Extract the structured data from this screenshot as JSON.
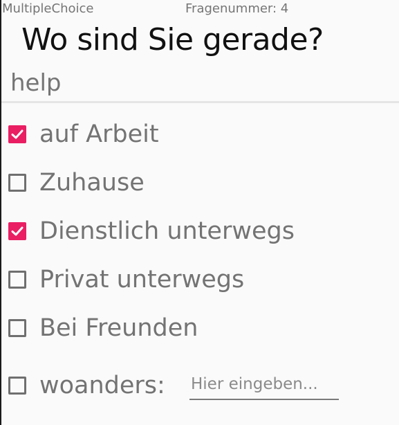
{
  "header": {
    "question_type": "MultipleChoice",
    "question_number": "Fragenummer: 4",
    "question": "Wo sind Sie gerade?",
    "help": "help"
  },
  "options": [
    {
      "label": "auf Arbeit",
      "checked": true
    },
    {
      "label": "Zuhause",
      "checked": false
    },
    {
      "label": "Dienstlich unterwegs",
      "checked": true
    },
    {
      "label": "Privat unterwegs",
      "checked": false
    },
    {
      "label": "Bei Freunden",
      "checked": false
    },
    {
      "label": "woanders:",
      "checked": false
    }
  ],
  "other_input": {
    "placeholder": "Hier eingeben...",
    "value": ""
  },
  "colors": {
    "accent": "#e91e63",
    "unchecked_border": "#6f6f6f",
    "label_text": "#737373"
  },
  "icons": {
    "checked": "checkbox-checked-icon",
    "unchecked": "checkbox-unchecked-icon"
  }
}
